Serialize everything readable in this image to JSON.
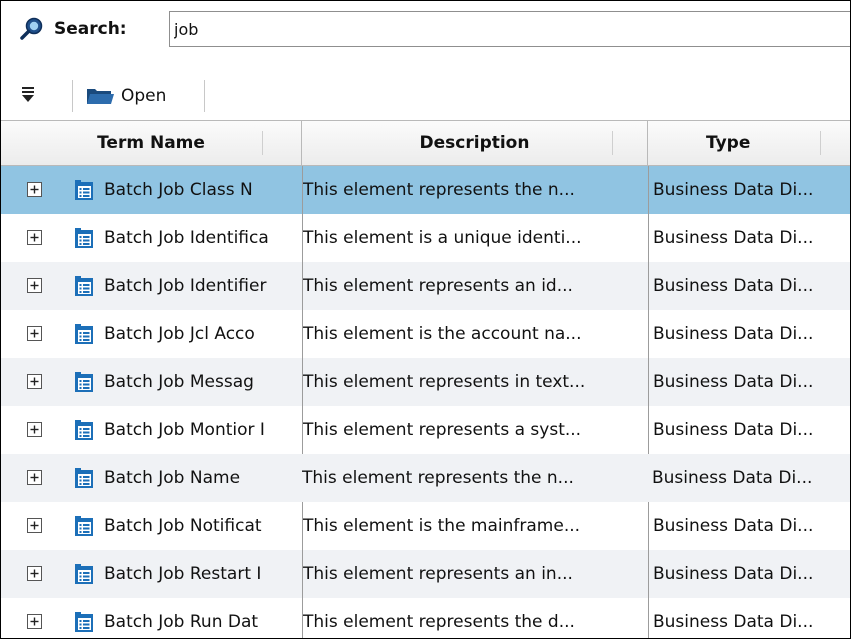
{
  "search": {
    "label": "Search:",
    "value": "job",
    "icon": "search-icon"
  },
  "toolbar": {
    "filter_icon": "filter-collapse-icon",
    "open_label": "Open",
    "open_icon": "folder-icon"
  },
  "table": {
    "columns": [
      "Term Name",
      "Description",
      "Type"
    ],
    "selected_row": 0,
    "rows": [
      {
        "term": "Batch Job Class N",
        "description": "This element represents the n...",
        "type": "Business Data Di..."
      },
      {
        "term": "Batch Job Identifica",
        "description": "This element is a unique identi...",
        "type": "Business Data Di..."
      },
      {
        "term": "Batch Job Identifier",
        "description": "This element represents an id...",
        "type": "Business Data Di..."
      },
      {
        "term": "Batch Job Jcl Acco",
        "description": "This element is the account na...",
        "type": "Business Data Di..."
      },
      {
        "term": "Batch Job Messag",
        "description": "This element represents in text...",
        "type": "Business Data Di..."
      },
      {
        "term": "Batch Job Montior I",
        "description": "This element represents a syst...",
        "type": "Business Data Di..."
      },
      {
        "term": "Batch Job Name",
        "description": "This element represents the n...",
        "type": "Business Data Di..."
      },
      {
        "term": "Batch Job Notificat",
        "description": "This element is the mainframe...",
        "type": "Business Data Di..."
      },
      {
        "term": "Batch Job Restart I",
        "description": "This element represents an in...",
        "type": "Business Data Di..."
      },
      {
        "term": "Batch Job Run Dat",
        "description": "This element represents the d...",
        "type": "Business Data Di..."
      }
    ]
  },
  "colors": {
    "selected_row": "#90c4e2",
    "alt_row": "#f0f2f5",
    "icon_blue": "#1c6fb8"
  }
}
